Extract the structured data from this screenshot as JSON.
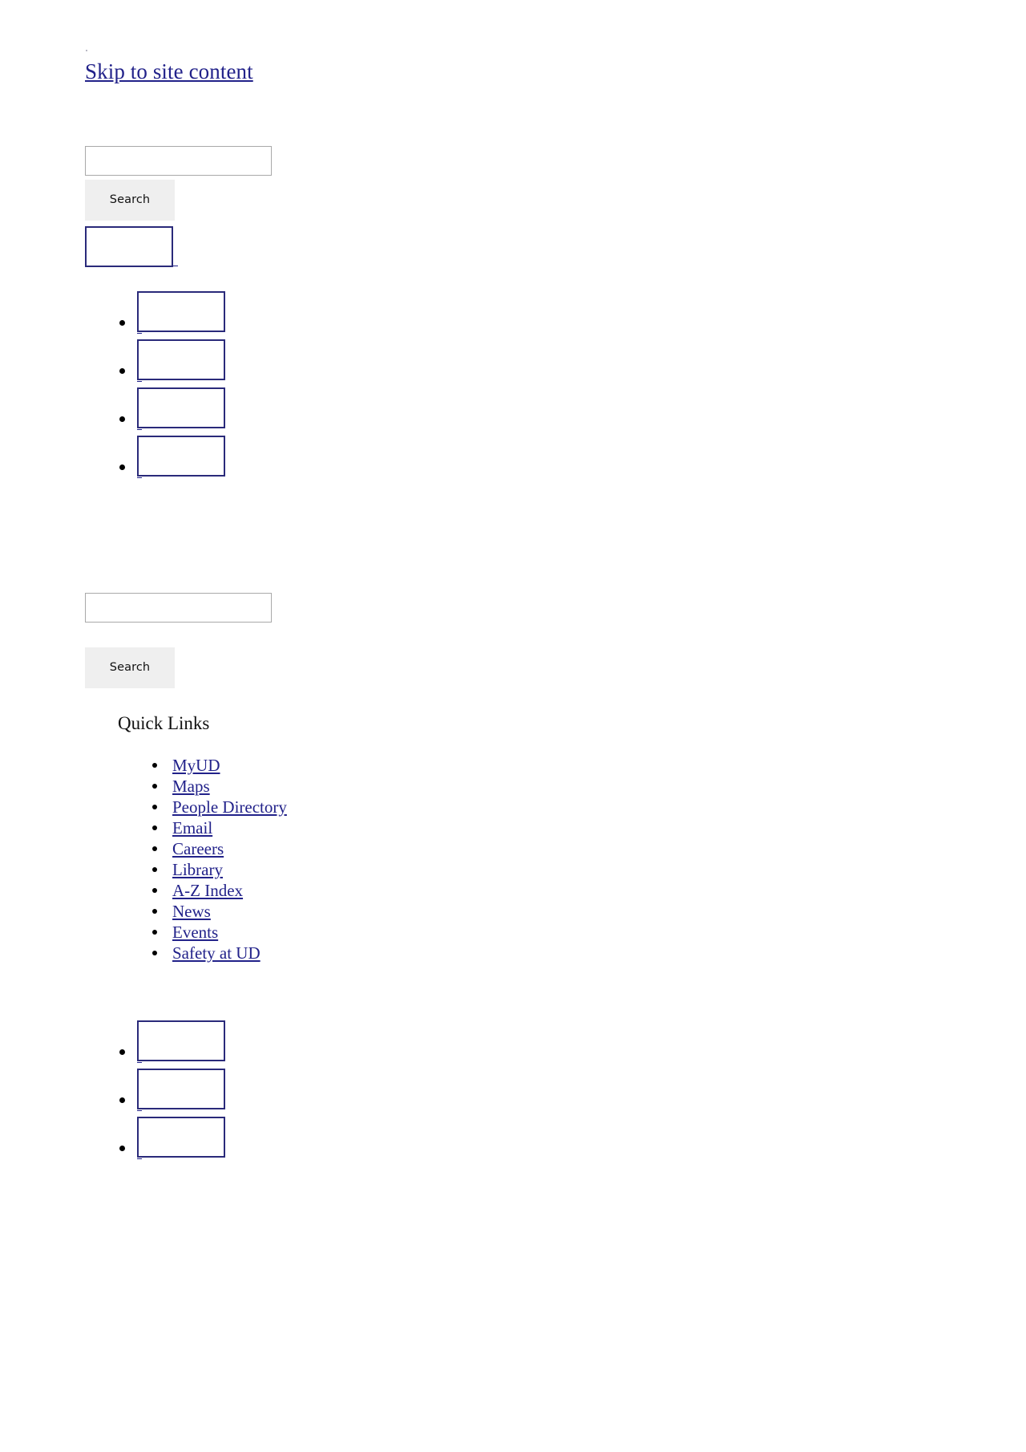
{
  "page": {
    "skip_link": "Skip to site content"
  },
  "search_top": {
    "input_value": "",
    "placeholder": "",
    "button_label": "Search"
  },
  "search_bottom": {
    "input_value": "",
    "placeholder": "",
    "button_label": "Search"
  },
  "branding": {
    "logo_alt": ""
  },
  "nav_image_items": [
    {
      "alt": ""
    },
    {
      "alt": ""
    },
    {
      "alt": ""
    },
    {
      "alt": ""
    }
  ],
  "quick_links": {
    "heading": "Quick Links",
    "items": [
      {
        "label": "MyUD"
      },
      {
        "label": "Maps"
      },
      {
        "label": "People Directory"
      },
      {
        "label": "Email"
      },
      {
        "label": "Careers"
      },
      {
        "label": "Library"
      },
      {
        "label": "A-Z Index"
      },
      {
        "label": "News"
      },
      {
        "label": "Events"
      },
      {
        "label": "Safety at UD"
      }
    ]
  },
  "social_image_items": [
    {
      "alt": ""
    },
    {
      "alt": ""
    },
    {
      "alt": ""
    }
  ],
  "colors": {
    "link": "#22228a",
    "broken_image_border": "#2a2a7a",
    "button_background": "#efefef",
    "input_border": "#a9a9a9"
  }
}
